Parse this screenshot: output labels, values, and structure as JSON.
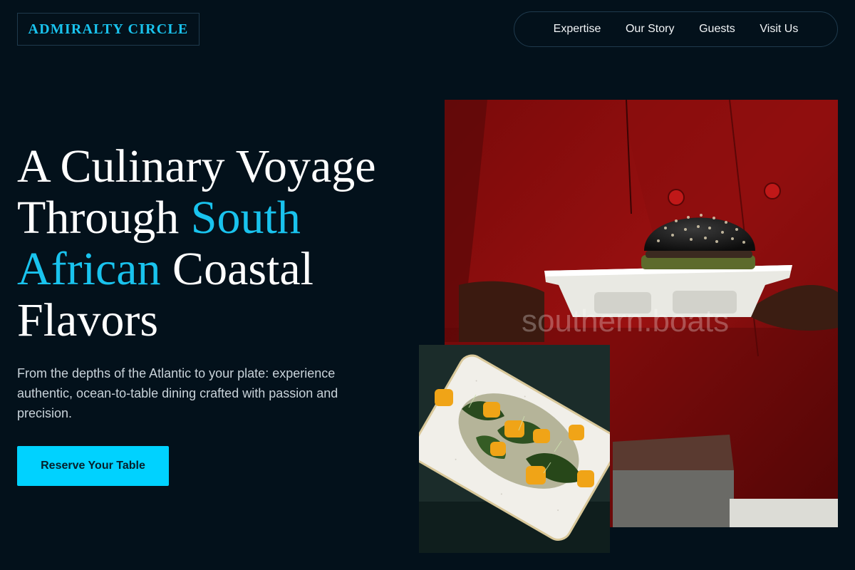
{
  "brand": {
    "name": "ADMIRALTY CIRCLE"
  },
  "nav": {
    "items": [
      {
        "label": "Expertise"
      },
      {
        "label": "Our Story"
      },
      {
        "label": "Guests"
      },
      {
        "label": "Visit Us"
      }
    ]
  },
  "hero": {
    "headline_part1": "A Culinary Voyage Through ",
    "headline_accent": "South African",
    "headline_part2": " Coastal Flavors",
    "subtext": "From the depths of the Atlantic to your plate: experience authentic, ocean-to-table dining crafted with passion and precision.",
    "cta_label": "Reserve Your Table"
  },
  "images": {
    "main_watermark": "southern.boats"
  },
  "colors": {
    "background": "#03111b",
    "accent": "#19c3ee",
    "cta": "#00d2ff",
    "border": "#1f3a4d"
  }
}
